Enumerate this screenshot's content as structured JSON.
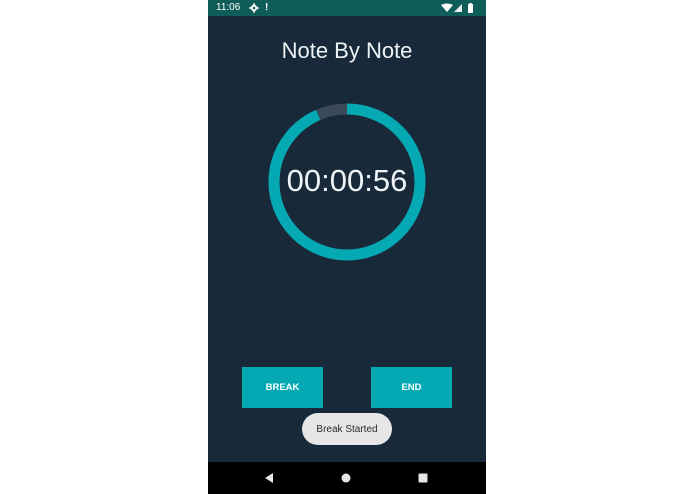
{
  "status_bar": {
    "time": "11:06",
    "icons": [
      "gear-icon",
      "alert-icon",
      "wifi-icon",
      "signal-icon",
      "battery-icon"
    ],
    "alert_glyph": "!"
  },
  "app": {
    "title": "Note By Note"
  },
  "timer": {
    "display": "00:00:56",
    "progress_fraction": 0.935,
    "ring_color": "#04a9b4",
    "ring_track_color": "#3b4a58"
  },
  "buttons": {
    "break_label": "BREAK",
    "end_label": "END"
  },
  "toast": {
    "message": "Break Started"
  },
  "nav_bar": {
    "icons": [
      "back-icon",
      "home-icon",
      "recents-icon"
    ]
  },
  "colors": {
    "background": "#18293a",
    "status_bar": "#0e5d58",
    "accent": "#04a9b4",
    "toast_bg": "#e6e6e6"
  }
}
